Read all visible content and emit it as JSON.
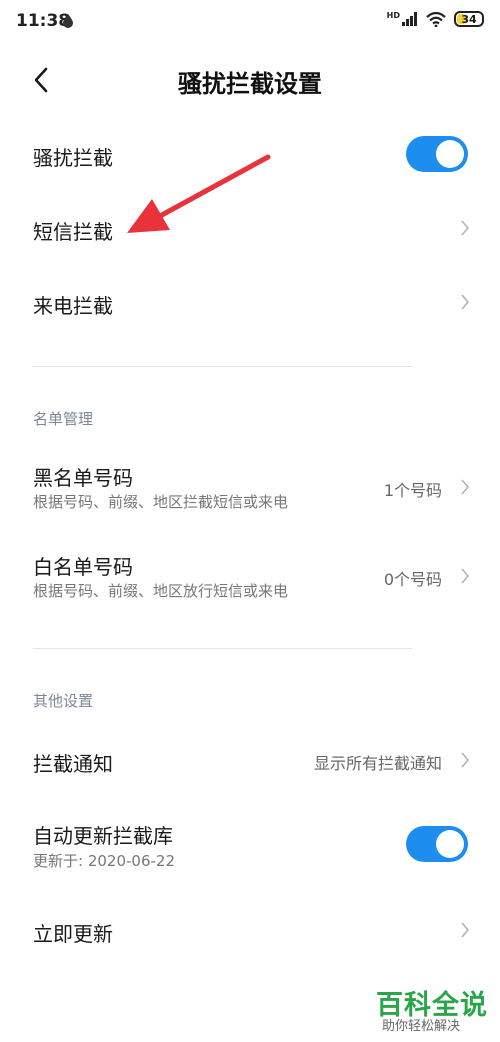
{
  "status_bar": {
    "time": "11:38",
    "network_badge": "HD",
    "battery": "34",
    "battery_color": "#f2d23a"
  },
  "header": {
    "title": "骚扰拦截设置"
  },
  "main": {
    "harassment_block": {
      "label": "骚扰拦截",
      "toggle_on": true
    },
    "sms_block": {
      "label": "短信拦截"
    },
    "call_block": {
      "label": "来电拦截"
    }
  },
  "list_management": {
    "header": "名单管理",
    "blacklist": {
      "label": "黑名单号码",
      "subtitle": "根据号码、前缀、地区拦截短信或来电",
      "value": "1个号码"
    },
    "whitelist": {
      "label": "白名单号码",
      "subtitle": "根据号码、前缀、地区放行短信或来电",
      "value": "0个号码"
    }
  },
  "other_settings": {
    "header": "其他设置",
    "block_notification": {
      "label": "拦截通知",
      "value": "显示所有拦截通知"
    },
    "auto_update": {
      "label": "自动更新拦截库",
      "subtitle": "更新于: 2020-06-22",
      "toggle_on": true
    },
    "update_now": {
      "label": "立即更新"
    }
  },
  "watermark": {
    "main": "百科全说",
    "sub": "助你轻松解决"
  },
  "colors": {
    "accent": "#1d8eef",
    "annotation_arrow": "#e8333a",
    "watermark": "#2aa64a"
  }
}
